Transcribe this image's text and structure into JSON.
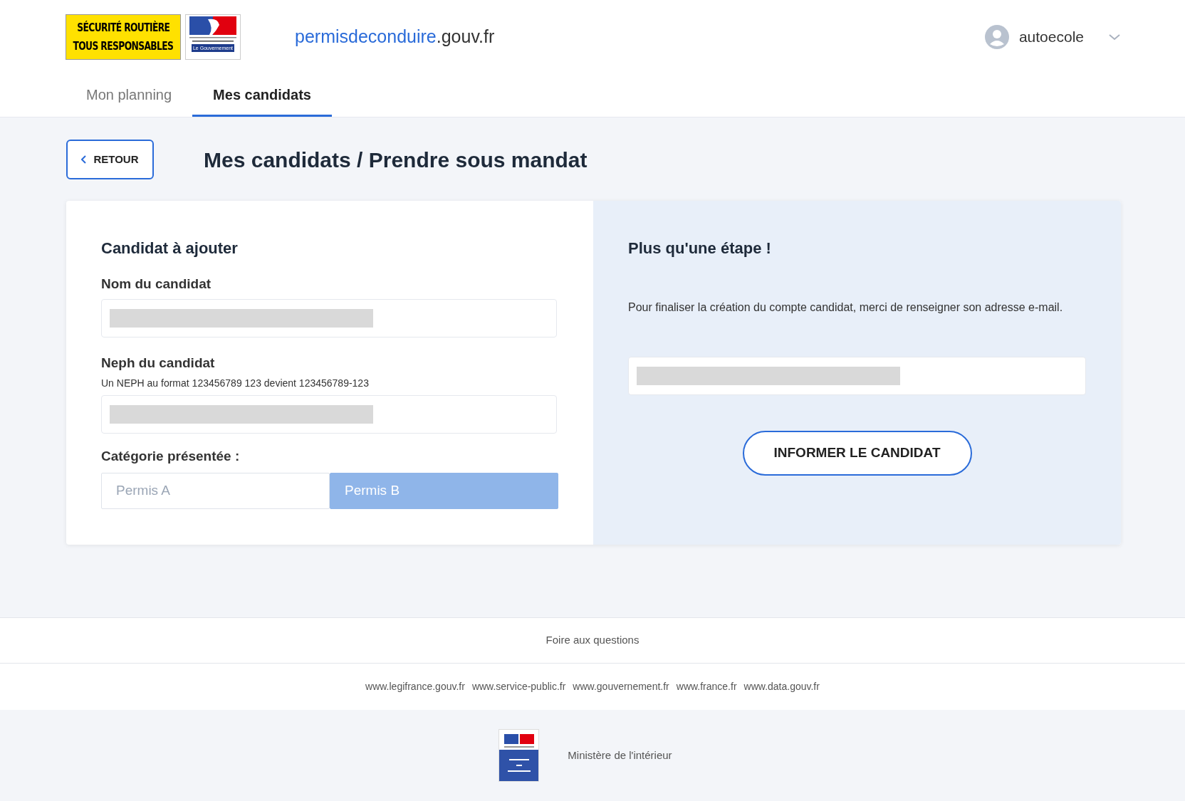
{
  "header": {
    "logo_road_safety": [
      "SÉCURITÉ ROUTIÈRE",
      "TOUS RESPONSABLES"
    ],
    "logo_republic": {
      "badge": "Le Gouvernement"
    },
    "site": {
      "name": "permisdeconduire",
      "suffix": ".gouv.fr"
    },
    "user": {
      "name": "autoecole"
    }
  },
  "tabs": [
    {
      "label": "Mon planning",
      "selected": false
    },
    {
      "label": "Mes candidats",
      "selected": true
    }
  ],
  "back_button": "RETOUR",
  "page_title": "Mes candidats / Prendre sous mandat",
  "left_panel": {
    "title": "Candidat à ajouter",
    "fields": [
      {
        "label": "Nom du candidat",
        "redacted": true
      },
      {
        "label": "Neph du candidat",
        "hint": "Un NEPH au format 123456789 123 devient 123456789-123",
        "redacted": true
      }
    ],
    "category": {
      "label": "Catégorie présentée :",
      "options": [
        {
          "label": "Permis A",
          "selected": false
        },
        {
          "label": "Permis B",
          "selected": true
        }
      ]
    }
  },
  "right_panel": {
    "title": "Plus qu'une étape !",
    "text": "Pour finaliser la création du compte candidat, merci de renseigner son adresse e-mail.",
    "email_redacted": true,
    "button": "INFORMER LE CANDIDAT"
  },
  "footer": {
    "faq": "Foire aux questions",
    "links": [
      "www.legifrance.gouv.fr",
      "www.service-public.fr",
      "www.gouvernement.fr",
      "www.france.fr",
      "www.data.gouv.fr"
    ],
    "ministry": "Ministère de l'intérieur"
  }
}
